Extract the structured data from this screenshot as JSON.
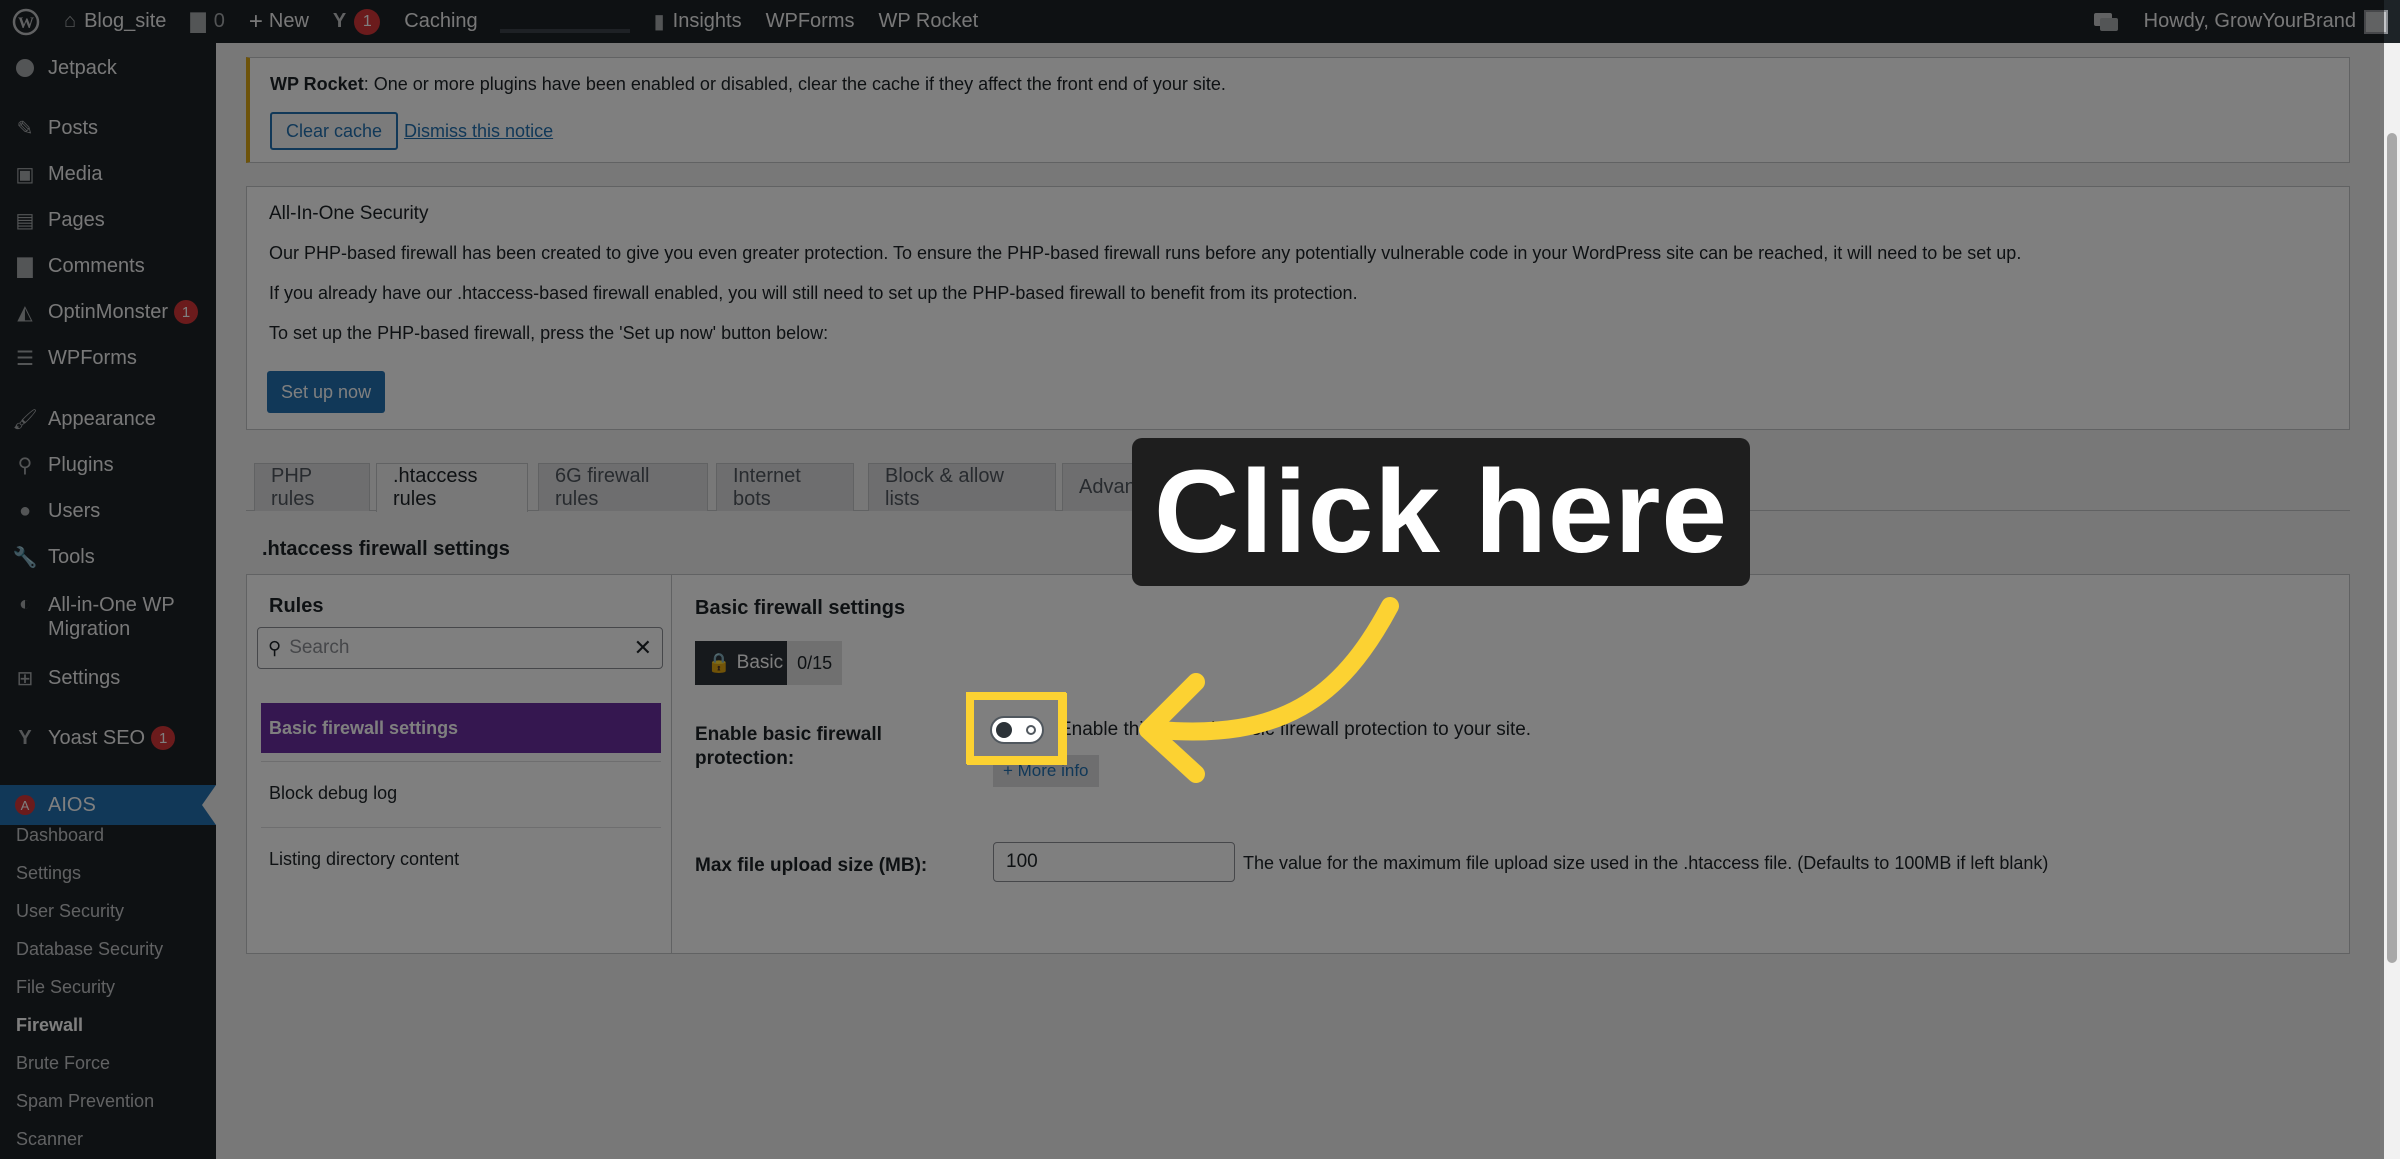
{
  "adminbar": {
    "site_name": "Blog_site",
    "comments_count": "0",
    "new_label": "New",
    "yoast_badge": "1",
    "caching_label": "Caching",
    "insights_label": "Insights",
    "wpforms_label": "WPForms",
    "wprocket_label": "WP Rocket",
    "howdy": "Howdy, GrowYourBrand"
  },
  "sidebar": {
    "items": [
      {
        "label": "Jetpack",
        "icon": "jetpack-icon"
      },
      {
        "label": "Posts",
        "icon": "pin-icon"
      },
      {
        "label": "Media",
        "icon": "media-icon"
      },
      {
        "label": "Pages",
        "icon": "pages-icon"
      },
      {
        "label": "Comments",
        "icon": "comment-icon"
      },
      {
        "label": "OptinMonster",
        "icon": "optinmonster-icon",
        "badge": "1"
      },
      {
        "label": "WPForms",
        "icon": "wpforms-icon"
      },
      {
        "label": "Appearance",
        "icon": "brush-icon"
      },
      {
        "label": "Plugins",
        "icon": "plugin-icon"
      },
      {
        "label": "Users",
        "icon": "user-icon"
      },
      {
        "label": "Tools",
        "icon": "wrench-icon"
      },
      {
        "label": "All-in-One WP",
        "label2": "Migration",
        "icon": "migration-icon"
      },
      {
        "label": "Settings",
        "icon": "settings-icon"
      },
      {
        "label": "Yoast SEO",
        "icon": "yoast-icon",
        "badge": "1"
      },
      {
        "label": "AIOS",
        "icon": "aios-icon"
      }
    ],
    "submenu": [
      "Dashboard",
      "Settings",
      "User Security",
      "Database Security",
      "File Security",
      "Firewall",
      "Brute Force",
      "Spam Prevention",
      "Scanner"
    ]
  },
  "notice_rocket": {
    "brand": "WP Rocket",
    "text": ": One or more plugins have been enabled or disabled, clear the cache if they affect the front end of your site.",
    "clear_cache": "Clear cache",
    "dismiss": "Dismiss this notice"
  },
  "notice_aios": {
    "title": "All-In-One Security",
    "p1": "Our PHP-based firewall has been created to give you even greater protection. To ensure the PHP-based firewall runs before any potentially vulnerable code in your WordPress site can be reached, it will need to be set up.",
    "p2": "If you already have our .htaccess-based firewall enabled, you will still need to set up the PHP-based firewall to benefit from its protection.",
    "p3": "To set up the PHP-based firewall, press the 'Set up now' button below:",
    "setup_button": "Set up now"
  },
  "tabs": [
    "PHP rules",
    ".htaccess rules",
    "6G firewall rules",
    "Internet bots",
    "Block & allow lists",
    "Advanced settings"
  ],
  "section_title": ".htaccess firewall settings",
  "rules_panel": {
    "heading": "Rules",
    "search_placeholder": "Search",
    "items": [
      "Basic firewall settings",
      "Block debug log",
      "Listing directory content"
    ]
  },
  "settings": {
    "heading": "Basic firewall settings",
    "badge_label": "Basic",
    "badge_count": "0/15",
    "enable_label": "Enable basic firewall protection:",
    "enable_desc": "Enable this to apply basic firewall protection to your site.",
    "more_info": "+ More info",
    "upload_label": "Max file upload size (MB):",
    "upload_value": "100",
    "upload_desc": "The value for the maximum file upload size used in the .htaccess file. (Defaults to 100MB if left blank)"
  },
  "callout": {
    "text": "Click here"
  },
  "colors": {
    "accent": "#2271b1",
    "highlight": "#fcd232",
    "active_rule": "#6b2fa0",
    "adminbar": "#1d2327"
  }
}
